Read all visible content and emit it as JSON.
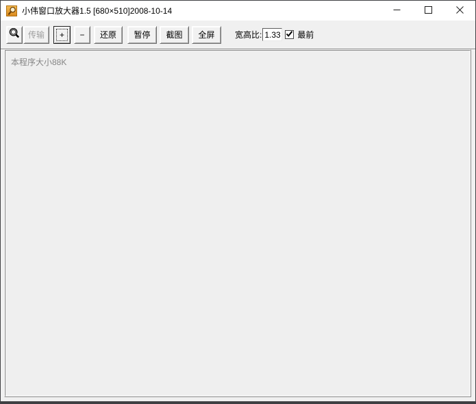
{
  "window": {
    "title": "小伟窗口放大器1.5 [680×510]2008-10-14"
  },
  "titlebar_icons": {
    "app": "magnifier-app-icon",
    "minimize": "minimize-icon",
    "maximize": "maximize-icon",
    "close": "close-icon"
  },
  "toolbar": {
    "buttons": [
      {
        "id": "magnifier",
        "label": "",
        "state": "normal",
        "icon": "magnifier-icon"
      },
      {
        "id": "transfer",
        "label": "传输",
        "state": "disabled"
      },
      {
        "id": "zoom-in",
        "label": "+",
        "state": "focused"
      },
      {
        "id": "zoom-out",
        "label": "−",
        "state": "normal"
      },
      {
        "id": "restore",
        "label": "还原",
        "state": "normal"
      },
      {
        "id": "pause",
        "label": "暂停",
        "state": "normal"
      },
      {
        "id": "screenshot",
        "label": "截图",
        "state": "normal"
      },
      {
        "id": "fullscreen",
        "label": "全屏",
        "state": "normal"
      }
    ],
    "aspect_ratio": {
      "label": "宽高比:",
      "value": "1.33"
    },
    "topmost": {
      "label": "最前",
      "checked": true
    }
  },
  "content": {
    "message": "本程序大小88K"
  },
  "colors": {
    "titlebar_bg": "#ffffff",
    "chrome_bg": "#f0f0f0",
    "window_border": "#3f4043",
    "app_icon_orange": "#e8981f",
    "disabled_text": "#9f9f9f",
    "status_text": "#858585"
  }
}
